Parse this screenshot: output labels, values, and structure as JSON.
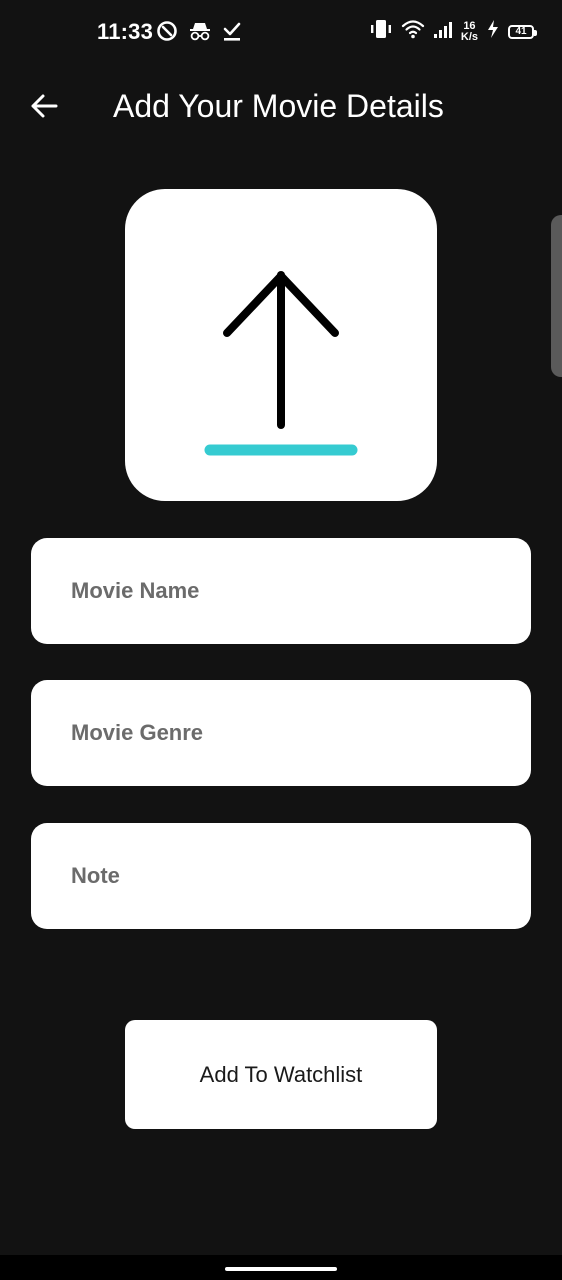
{
  "status_bar": {
    "time": "11:33",
    "net_speed_value": "16",
    "net_speed_unit": "K/s",
    "battery_level": "41",
    "left_icons": [
      "data-saver-icon",
      "incognito-icon",
      "download-done-icon"
    ],
    "right_icons": [
      "vibrate-icon",
      "wifi-icon",
      "signal-icon",
      "charging-icon",
      "battery-icon"
    ]
  },
  "app_bar": {
    "title": "Add Your Movie Details",
    "back_icon": "arrow-left-icon"
  },
  "upload": {
    "icon": "upload-icon",
    "accent_color": "#35cbd1"
  },
  "form": {
    "movie_name": {
      "placeholder": "Movie Name",
      "value": ""
    },
    "movie_genre": {
      "placeholder": "Movie Genre",
      "value": ""
    },
    "note": {
      "placeholder": "Note",
      "value": ""
    }
  },
  "actions": {
    "add_label": "Add To Watchlist"
  },
  "colors": {
    "background": "#121212",
    "surface": "#ffffff",
    "placeholder": "#6b6b6b"
  }
}
